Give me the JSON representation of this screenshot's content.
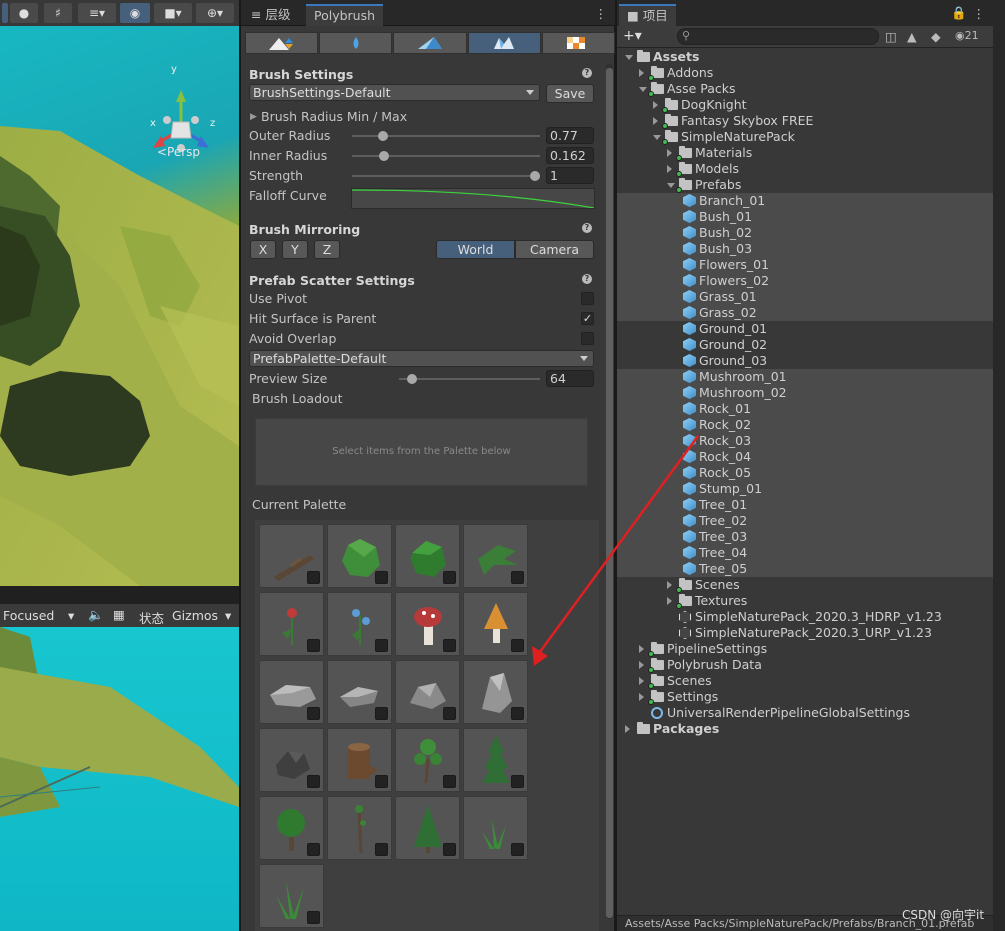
{
  "scene": {
    "persp_label": "<Persp",
    "axis_x": "x",
    "axis_y": "y",
    "axis_z": "z",
    "bottom_bar": {
      "focused_label": "Focused",
      "stats_label": "状态",
      "gizmos_label": "Gizmos"
    }
  },
  "polybrush": {
    "tabs": [
      {
        "label": "层级",
        "icon": "hierarchy-icon"
      },
      {
        "label": "Polybrush"
      }
    ],
    "modes": [
      "raise-lower-icon",
      "smooth-icon",
      "paint-vertex-icon",
      "scatter-prefab-icon",
      "paint-texture-icon"
    ],
    "active_mode": 3,
    "brush_settings": {
      "title": "Brush Settings",
      "preset": "BrushSettings-Default",
      "save_label": "Save",
      "radius_minmax_label": "Brush Radius Min / Max",
      "outer_radius_label": "Outer Radius",
      "outer_radius_value": "0.77",
      "outer_radius_fraction": 0.12,
      "inner_radius_label": "Inner Radius",
      "inner_radius_value": "0.162",
      "inner_radius_fraction": 0.17,
      "strength_label": "Strength",
      "strength_value": "1",
      "strength_fraction": 1.0,
      "falloff_label": "Falloff Curve"
    },
    "mirroring": {
      "title": "Brush Mirroring",
      "axes": [
        "X",
        "Y",
        "Z"
      ],
      "space_options": [
        "World",
        "Camera"
      ],
      "space_selected": "World"
    },
    "scatter": {
      "title": "Prefab Scatter Settings",
      "use_pivot_label": "Use Pivot",
      "use_pivot": false,
      "hit_surface_label": "Hit Surface is Parent",
      "hit_surface": true,
      "avoid_overlap_label": "Avoid Overlap",
      "avoid_overlap": false,
      "palette_preset": "PrefabPalette-Default",
      "preview_size_label": "Preview Size",
      "preview_size_value": "64",
      "loadout_label": "Brush Loadout",
      "loadout_placeholder": "Select items from the Palette below",
      "current_palette_label": "Current Palette"
    },
    "palette": [
      "Branch_01",
      "Bush_01",
      "Bush_02",
      "Bush_03",
      "Flowers_01",
      "Flowers_02",
      "Mushroom_01",
      "Mushroom_02",
      "Rock_01",
      "Rock_02",
      "Rock_03",
      "Rock_04",
      "Rock_05",
      "Stump_01",
      "Tree_01",
      "Tree_02",
      "Tree_03",
      "Tree_04",
      "Tree_05",
      "Grass_01"
    ]
  },
  "project": {
    "tab_label": "项目",
    "hidden_count": "21",
    "tree": [
      {
        "label": "Assets",
        "depth": 0,
        "type": "folder",
        "expanded": true,
        "bold": true
      },
      {
        "label": "Addons",
        "depth": 1,
        "type": "folder",
        "expanded": false
      },
      {
        "label": "Asse Packs",
        "depth": 1,
        "type": "folder",
        "expanded": true
      },
      {
        "label": "DogKnight",
        "depth": 2,
        "type": "folder",
        "expanded": false
      },
      {
        "label": "Fantasy Skybox FREE",
        "depth": 2,
        "type": "folder",
        "expanded": false
      },
      {
        "label": "SimpleNaturePack",
        "depth": 2,
        "type": "folder",
        "expanded": true
      },
      {
        "label": "Materials",
        "depth": 3,
        "type": "folder",
        "expanded": false
      },
      {
        "label": "Models",
        "depth": 3,
        "type": "folder",
        "expanded": false
      },
      {
        "label": "Prefabs",
        "depth": 3,
        "type": "folder",
        "expanded": true
      },
      {
        "label": "Branch_01",
        "depth": 4,
        "type": "prefab",
        "selected": true
      },
      {
        "label": "Bush_01",
        "depth": 4,
        "type": "prefab",
        "selected": true
      },
      {
        "label": "Bush_02",
        "depth": 4,
        "type": "prefab",
        "selected": true
      },
      {
        "label": "Bush_03",
        "depth": 4,
        "type": "prefab",
        "selected": true
      },
      {
        "label": "Flowers_01",
        "depth": 4,
        "type": "prefab",
        "selected": true
      },
      {
        "label": "Flowers_02",
        "depth": 4,
        "type": "prefab",
        "selected": true
      },
      {
        "label": "Grass_01",
        "depth": 4,
        "type": "prefab",
        "selected": true
      },
      {
        "label": "Grass_02",
        "depth": 4,
        "type": "prefab",
        "selected": true
      },
      {
        "label": "Ground_01",
        "depth": 4,
        "type": "prefab",
        "selected": false
      },
      {
        "label": "Ground_02",
        "depth": 4,
        "type": "prefab",
        "selected": false
      },
      {
        "label": "Ground_03",
        "depth": 4,
        "type": "prefab",
        "selected": false
      },
      {
        "label": "Mushroom_01",
        "depth": 4,
        "type": "prefab",
        "selected": true
      },
      {
        "label": "Mushroom_02",
        "depth": 4,
        "type": "prefab",
        "selected": true
      },
      {
        "label": "Rock_01",
        "depth": 4,
        "type": "prefab",
        "selected": true
      },
      {
        "label": "Rock_02",
        "depth": 4,
        "type": "prefab",
        "selected": true
      },
      {
        "label": "Rock_03",
        "depth": 4,
        "type": "prefab",
        "selected": true
      },
      {
        "label": "Rock_04",
        "depth": 4,
        "type": "prefab",
        "selected": true
      },
      {
        "label": "Rock_05",
        "depth": 4,
        "type": "prefab",
        "selected": true
      },
      {
        "label": "Stump_01",
        "depth": 4,
        "type": "prefab",
        "selected": true
      },
      {
        "label": "Tree_01",
        "depth": 4,
        "type": "prefab",
        "selected": true
      },
      {
        "label": "Tree_02",
        "depth": 4,
        "type": "prefab",
        "selected": true
      },
      {
        "label": "Tree_03",
        "depth": 4,
        "type": "prefab",
        "selected": true
      },
      {
        "label": "Tree_04",
        "depth": 4,
        "type": "prefab",
        "selected": true
      },
      {
        "label": "Tree_05",
        "depth": 4,
        "type": "prefab",
        "selected": true
      },
      {
        "label": "Scenes",
        "depth": 3,
        "type": "folder",
        "expanded": false
      },
      {
        "label": "Textures",
        "depth": 3,
        "type": "folder",
        "expanded": false
      },
      {
        "label": "SimpleNaturePack_2020.3_HDRP_v1.23",
        "depth": 3,
        "type": "scene"
      },
      {
        "label": "SimpleNaturePack_2020.3_URP_v1.23",
        "depth": 3,
        "type": "scene"
      },
      {
        "label": "PipelineSettings",
        "depth": 1,
        "type": "folder",
        "expanded": false
      },
      {
        "label": "Polybrush Data",
        "depth": 1,
        "type": "folder",
        "expanded": false
      },
      {
        "label": "Scenes",
        "depth": 1,
        "type": "folder",
        "expanded": false
      },
      {
        "label": "Settings",
        "depth": 1,
        "type": "folder",
        "expanded": false
      },
      {
        "label": "UniversalRenderPipelineGlobalSettings",
        "depth": 1,
        "type": "settings"
      },
      {
        "label": "Packages",
        "depth": 0,
        "type": "folder",
        "expanded": false,
        "bold": true
      }
    ],
    "path": "Assets/Asse Packs/SimpleNaturePack/Prefabs/Branch_01.prefab"
  },
  "watermark": "CSDN @向宇it",
  "colors": {
    "accent": "#3a79bb",
    "selected_button": "#46607c",
    "annotation_arrow": "#e02020",
    "falloff_curve": "#3cd43c"
  }
}
